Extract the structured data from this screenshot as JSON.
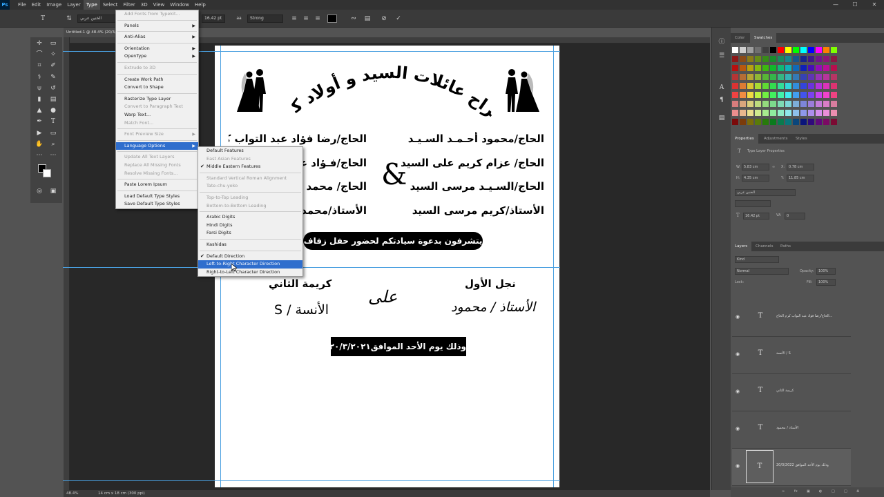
{
  "menubar": {
    "logo": "Ps",
    "items": [
      "File",
      "Edit",
      "Image",
      "Layer",
      "Type",
      "Select",
      "Filter",
      "3D",
      "View",
      "Window",
      "Help"
    ],
    "active": "Type"
  },
  "optionsbar": {
    "font_family": "الخنين عربي",
    "font_size": "16.42 pt",
    "antialias_icon": "aa",
    "antialias": "Strong"
  },
  "document": {
    "tab_title": "Untitled-1 @ 48.4% (20/3/",
    "zoom": "48.4%",
    "doc_size": "14 cm x 18 cm (300 ppi)"
  },
  "canvas": {
    "title": "أفراح عائلات السيد و أولاد كرم",
    "ampersand": "&",
    "left_col": [
      "الحاج/رضا فؤاد عبد التواب كرم",
      "الحاج/فـؤاد عبـ",
      "الحاج/ محمد فـ",
      "الأستاذ/محمد ر"
    ],
    "right_col": [
      "الحاج/محمود أحـمـد السـيـد",
      "الحاج/ عزام كريم على السيد",
      "الحاج/السـيـد مرسى السيد",
      "الأستاذ/كريم مرسى السيد"
    ],
    "invite": "يتشرفون بدعوة سيادتكم لحضور حفل زفاف",
    "groom_label": "نجل الأول",
    "groom_name": "الأستاذ / محمود",
    "ala": "على",
    "bride_label": "كريمة الثاني",
    "bride_name": "الأنسة / S",
    "date_line": "وذلك يوم الأحد الموافق٢٠/٣/٢٠٢١"
  },
  "type_menu": {
    "items": [
      {
        "label": "Add Fonts from Typekit...",
        "disabled": true
      },
      {
        "sep": true
      },
      {
        "label": "Panels",
        "arrow": true
      },
      {
        "sep": true
      },
      {
        "label": "Anti-Alias",
        "arrow": true
      },
      {
        "sep": true
      },
      {
        "label": "Orientation",
        "arrow": true
      },
      {
        "label": "OpenType",
        "arrow": true
      },
      {
        "sep": true
      },
      {
        "label": "Extrude to 3D",
        "disabled": true
      },
      {
        "sep": true
      },
      {
        "label": "Create Work Path"
      },
      {
        "label": "Convert to Shape"
      },
      {
        "sep": true
      },
      {
        "label": "Rasterize Type Layer"
      },
      {
        "label": "Convert to Paragraph Text",
        "disabled": true
      },
      {
        "label": "Warp Text..."
      },
      {
        "label": "Match Font...",
        "disabled": true
      },
      {
        "sep": true
      },
      {
        "label": "Font Preview Size",
        "arrow": true,
        "disabled": true
      },
      {
        "sep": true
      },
      {
        "label": "Language Options",
        "arrow": true,
        "highlight": true
      },
      {
        "sep": true
      },
      {
        "label": "Update All Text Layers",
        "disabled": true
      },
      {
        "label": "Replace All Missing Fonts",
        "disabled": true
      },
      {
        "label": "Resolve Missing Fonts...",
        "disabled": true
      },
      {
        "sep": true
      },
      {
        "label": "Paste Lorem Ipsum"
      },
      {
        "sep": true
      },
      {
        "label": "Load Default Type Styles"
      },
      {
        "label": "Save Default Type Styles"
      }
    ]
  },
  "language_submenu": {
    "items": [
      {
        "label": "Default Features"
      },
      {
        "label": "East Asian Features",
        "disabled": true
      },
      {
        "label": "Middle Eastern Features",
        "checked": true
      },
      {
        "sep": true
      },
      {
        "label": "Standard Vertical Roman Alignment",
        "disabled": true
      },
      {
        "label": "Tate-chu-yoko",
        "disabled": true
      },
      {
        "sep": true
      },
      {
        "label": "Top-to-Top Leading",
        "disabled": true
      },
      {
        "label": "Bottom-to-Bottom Leading",
        "disabled": true
      },
      {
        "sep": true
      },
      {
        "label": "Arabic Digits"
      },
      {
        "label": "Hindi Digits"
      },
      {
        "label": "Farsi Digits"
      },
      {
        "sep": true
      },
      {
        "label": "Kashidas"
      },
      {
        "sep": true
      },
      {
        "label": "Default Direction",
        "checked": true
      },
      {
        "label": "Left-to-Right Character Direction",
        "highlight": true
      },
      {
        "label": "Right-to-Left Character Direction"
      }
    ]
  },
  "swatches_panel": {
    "tabs": [
      "Color",
      "Swatches"
    ],
    "active": "Swatches"
  },
  "properties_panel": {
    "tabs": [
      "Properties",
      "Adjustments",
      "Styles"
    ],
    "active": "Properties",
    "title": "Type Layer Properties",
    "w": "5.83 cm",
    "h": "4.35 cm",
    "x": "0.78 cm",
    "y": "11.85 cm",
    "font": "الخنين عربي",
    "size": "16.42 pt",
    "tracking": "0"
  },
  "layers_panel": {
    "tabs": [
      "Layers",
      "Channels",
      "Paths"
    ],
    "active": "Layers",
    "filter": "Kind",
    "blend_mode": "Normal",
    "opacity_label": "Opacity:",
    "opacity": "100%",
    "lock_label": "Lock:",
    "fill_label": "Fill:",
    "fill": "100%",
    "layers": [
      {
        "name": "الحاج/رضا فؤاد عبد التواب كرم الحاج..."
      },
      {
        "name": "الأنسة / S"
      },
      {
        "name": "كريمة الثاني"
      },
      {
        "name": "الأستاذ / محمود"
      },
      {
        "name": "وذلك يوم الأحد الموافق 20/3/2022",
        "selected": true
      }
    ]
  }
}
